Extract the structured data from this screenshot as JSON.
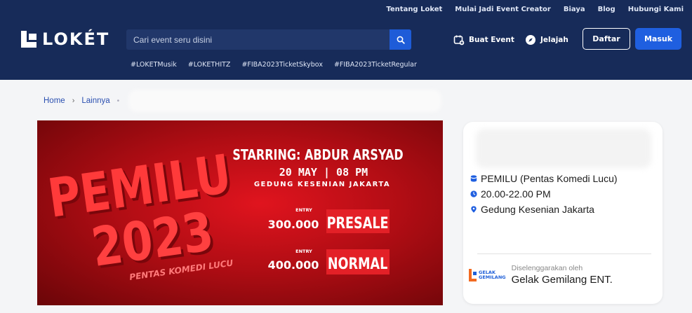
{
  "topnav": [
    "Tentang Loket",
    "Mulai Jadi Event Creator",
    "Biaya",
    "Blog",
    "Hubungi Kami"
  ],
  "logo": {
    "text": "LOKÉT"
  },
  "search": {
    "placeholder": "Cari event seru disini",
    "icon": "search-icon"
  },
  "hashtags": [
    "#LOKETMusik",
    "#LOKETHITZ",
    "#FIBA2023TicketSkybox",
    "#FIBA2023TicketRegular"
  ],
  "actions": {
    "create": "Buat Event",
    "explore": "Jelajah",
    "register": "Daftar",
    "login": "Masuk"
  },
  "breadcrumb": {
    "home": "Home",
    "category": "Lainnya"
  },
  "banner": {
    "title_line1": "PEMILU",
    "title_line2": "2023",
    "subtitle": "PENTAS KOMEDI LUCU",
    "starring": "STARRING: ABDUR ARSYAD",
    "datetime": "20 MAY | 08 PM",
    "venue": "GEDUNG KESENIAN JAKARTA",
    "entry_label": "ENTRY",
    "presale_price": "300.000",
    "presale_label": "PRESALE",
    "normal_price": "400.000",
    "normal_label": "NORMAL"
  },
  "event_info": {
    "name": "PEMILU (Pentas Komedi Lucu)",
    "time": "20.00-22.00 PM",
    "location": "Gedung Kesenian Jakarta"
  },
  "organizer": {
    "logo_line1": "GELAK",
    "logo_line2": "GEMILANG",
    "label": "Diselenggarakan oleh",
    "name": "Gelak Gemilang ENT."
  },
  "colors": {
    "header": "#172b59",
    "accent": "#1f5fe0",
    "banner_red": "#c8101a"
  }
}
